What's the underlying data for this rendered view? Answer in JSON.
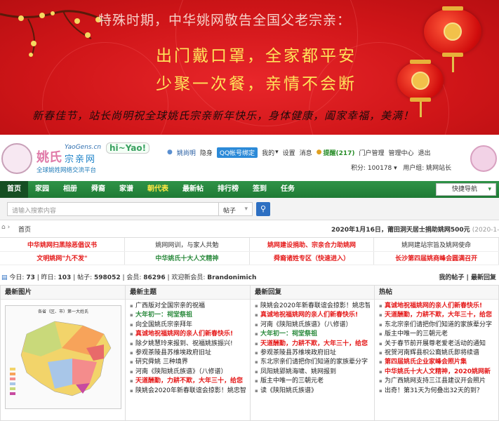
{
  "banner": {
    "top_line": "特殊时期，中华姚网敬告全国父老宗亲：",
    "line1": "出门戴口罩，全家都平安",
    "line2": "少聚一次餐，亲情不会断",
    "bottom_line": "新春佳节，站长尚明祝全球姚氏宗亲新年快乐，身体健康，阖家幸福，美满！"
  },
  "header": {
    "logo_main": "姚氏",
    "logo_domain": "YaoGens.cn",
    "logo_sub": "宗亲网",
    "logo_slogan": "全球姚姓网络交流平台",
    "hiyao": "hi~Yao!"
  },
  "userbar": {
    "username": "姚尚明",
    "hide": "隐身",
    "qq": "QQ帐号绑定",
    "mine": "我的",
    "settings": "设置",
    "messages": "消息",
    "reminders": "提醒(217)",
    "portal_mgmt": "门户管理",
    "admin_center": "管理中心",
    "logout": "退出",
    "credits": "积分: 100178",
    "usergroup": "用户组: 姚网站长"
  },
  "nav": {
    "items": [
      "首页",
      "家园",
      "相册",
      "舜裔",
      "家谱",
      "朝代表",
      "最新帖",
      "排行榜",
      "签到",
      "任务"
    ],
    "quick": "快捷导航"
  },
  "search": {
    "placeholder": "请输入搜索内容",
    "type": "帖子"
  },
  "breadcrumb": {
    "home": "首页",
    "notice": "2020年1月16日，莆田洞天居士捐助姚网500元",
    "notice_date": "(2020-1-19)"
  },
  "links": {
    "row1": [
      "中华姚网扫黑除恶倡议书",
      "姚网网训，与家人共勉",
      "姚网建设捐助、宗亲合力助姚网",
      "姚网建站宗旨及姚网使命"
    ],
    "row2": [
      "文明姚网\"九不发\"",
      "中华姚氏十大人文精神",
      "舜裔诸姓专区（快速进入）",
      "长沙第四届姚商峰会圆满召开"
    ]
  },
  "stats": {
    "today_label": "今日:",
    "today": "73",
    "yesterday_label": "昨日:",
    "yesterday": "103",
    "posts_label": "帖子:",
    "posts": "598052",
    "members_label": "会员:",
    "members": "86296",
    "welcome": "欢迎新会员:",
    "newmember": "Brandonimich",
    "my_posts": "我的帖子",
    "latest_replies": "最新回复"
  },
  "columns": {
    "images_title": "最新图片",
    "map_title": "各省（区、市）第一大姓氏",
    "topics_title": "最新主题",
    "topics": [
      {
        "t": "广西版对全国宗亲的祝福",
        "c": "blk"
      },
      {
        "t": "大年初一：祠堂祭祖",
        "c": "grn"
      },
      {
        "t": "向全国姚氏宗亲拜年",
        "c": "blk"
      },
      {
        "t": "真诚地祝福姚网的亲人们新春快乐!",
        "c": "red"
      },
      {
        "t": "除夕姚慧玲来报到、祝福姚族振兴!",
        "c": "blk"
      },
      {
        "t": "参观茶陵县苏维埃政府旧址",
        "c": "blk"
      },
      {
        "t": "研究舜姚 三种境界",
        "c": "blk"
      },
      {
        "t": "河南《陕阳姚氏族谱》（八修谱）",
        "c": "blk"
      },
      {
        "t": "天道酬勤，力耕不欺，大年三十，给您",
        "c": "red"
      },
      {
        "t": "陕姚会2020年新春联谊会掠影！姚忠智",
        "c": "blk"
      }
    ],
    "replies_title": "最新回复",
    "replies": [
      {
        "t": "陕姚会2020年新春联谊会掠影！姚忠智",
        "c": "blk"
      },
      {
        "t": "真诚地祝福姚网的亲人们新春快乐!",
        "c": "red"
      },
      {
        "t": "河南《陕阳姚氏族谱》（八修谱）",
        "c": "blk"
      },
      {
        "t": "大年初一：祠堂祭祖",
        "c": "grn"
      },
      {
        "t": "天道酬勤，力耕不欺，大年三十，给您",
        "c": "red"
      },
      {
        "t": "参观茶陵县苏维埃政府旧址",
        "c": "blk"
      },
      {
        "t": "东北宗亲们请把你们知道的家族辈分字",
        "c": "blk"
      },
      {
        "t": "凤阳姚郢姚海啸、姚网报到",
        "c": "blk"
      },
      {
        "t": "版主中唯一的三朝元老",
        "c": "blk"
      },
      {
        "t": "读《陕阳姚氏族谱》",
        "c": "blk"
      }
    ],
    "hot_title": "热帖",
    "hot": [
      {
        "t": "真诚地祝福姚网的亲人们新春快乐!",
        "c": "red"
      },
      {
        "t": "天道酬勤，力耕不欺，大年三十，给您",
        "c": "red"
      },
      {
        "t": "东北宗亲们请把你们知道的家族辈分字",
        "c": "blk"
      },
      {
        "t": "版主中唯一的三朝元老",
        "c": "blk"
      },
      {
        "t": "关于春节前开展尊老爱老活动的通知",
        "c": "blk"
      },
      {
        "t": "祝贺河南辉县枳公裔姚氏即将续谱",
        "c": "blk"
      },
      {
        "t": "第四届姚氏企业家峰会照片集",
        "c": "red"
      },
      {
        "t": "中华姚氏十大人文精神，2020姚网新",
        "c": "red"
      },
      {
        "t": "为广西姚网支持三江县建议开会照片",
        "c": "blk"
      },
      {
        "t": "出奇！第31天为何叠出32天的到？",
        "c": "blk"
      }
    ]
  }
}
